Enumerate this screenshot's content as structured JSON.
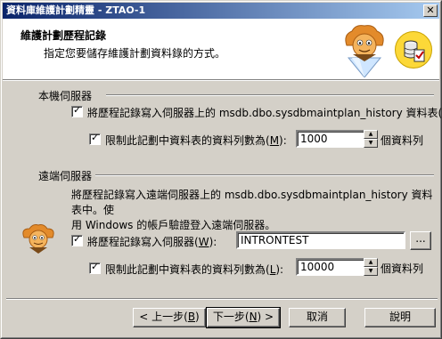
{
  "window": {
    "title": "資料庫維護計劃精靈 - ZTAO-1"
  },
  "header": {
    "title": "維護計劃歷程記錄",
    "subtitle": "指定您要儲存維護計劃資料錄的方式。"
  },
  "local": {
    "section_label": "本機伺服器",
    "write_checkbox": {
      "checked": true,
      "label_pre": "將歷程記錄寫入伺服器上的 msdb.dbo.sysdbmaintplan_history 資料表(",
      "hotkey": "H",
      "label_post": ")"
    },
    "limit_checkbox": {
      "checked": true,
      "label_pre": "限制此記劃中資料表的資料列數為(",
      "hotkey": "M",
      "label_post": "):"
    },
    "limit_value": "1000",
    "limit_unit": "個資料列"
  },
  "remote": {
    "section_label": "遠端伺服器",
    "description_line1": "將歷程記錄寫入遠端伺服器上的 msdb.dbo.sysdbmaintplan_history 資料表中。使",
    "description_line2": "用 Windows 的帳戶驗證登入遠端伺服器。",
    "write_checkbox": {
      "checked": true,
      "label_pre": "將歷程記錄寫入伺服器(",
      "hotkey": "W",
      "label_post": "):"
    },
    "server_value": "INTRONTEST",
    "browse_label": "...",
    "limit_checkbox": {
      "checked": true,
      "label_pre": "限制此記劃中資料表的資料列數為(",
      "hotkey": "L",
      "label_post": "):"
    },
    "limit_value": "10000",
    "limit_unit": "個資料列"
  },
  "footer": {
    "back": {
      "pre": "< 上一步(",
      "hotkey": "B",
      "post": ")"
    },
    "next": {
      "pre": "下一步(",
      "hotkey": "N",
      "post": ") >"
    },
    "cancel": "取消",
    "help": "說明"
  },
  "icons": {
    "wizard": "wizard-mascot-icon",
    "database": "database-checklist-icon",
    "remote_wizard": "wizard-mascot-small-icon",
    "close": "close-icon",
    "spin_up": "spin-up-icon",
    "spin_down": "spin-down-icon"
  },
  "colors": {
    "title_bar_start": "#0a246a",
    "title_bar_end": "#a6caf0",
    "dialog_bg": "#d4d0c8",
    "badge_yellow": "#fcd838"
  }
}
